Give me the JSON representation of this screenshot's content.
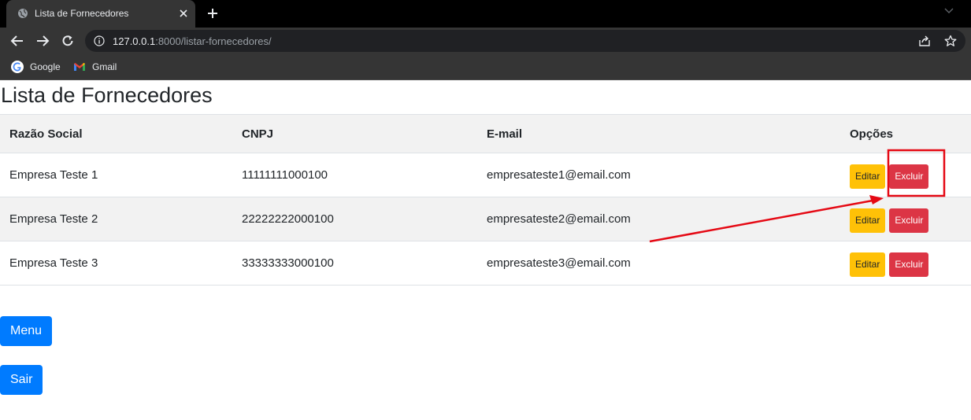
{
  "browser": {
    "tab_title": "Lista de Fornecedores",
    "url_host": "127.0.0.1",
    "url_rest": ":8000/listar-fornecedores/",
    "bookmarks": [
      {
        "label": "Google",
        "icon": "google-icon"
      },
      {
        "label": "Gmail",
        "icon": "gmail-icon"
      }
    ]
  },
  "page": {
    "title": "Lista de Fornecedores",
    "table": {
      "headers": [
        "Razão Social",
        "CNPJ",
        "E-mail",
        "Opções"
      ],
      "rows": [
        {
          "razao_social": "Empresa Teste 1",
          "cnpj": "11111111000100",
          "email": "empresateste1@email.com"
        },
        {
          "razao_social": "Empresa Teste 2",
          "cnpj": "22222222000100",
          "email": "empresateste2@email.com"
        },
        {
          "razao_social": "Empresa Teste 3",
          "cnpj": "33333333000100",
          "email": "empresateste3@email.com"
        }
      ],
      "edit_label": "Editar",
      "delete_label": "Excluir"
    },
    "menu_label": "Menu",
    "logout_label": "Sair"
  },
  "annotation": {
    "color": "#e50914",
    "highlight_target": "delete-button"
  },
  "colors": {
    "edit_button": "#ffc107",
    "delete_button": "#dc3545",
    "primary_button": "#007bff"
  }
}
